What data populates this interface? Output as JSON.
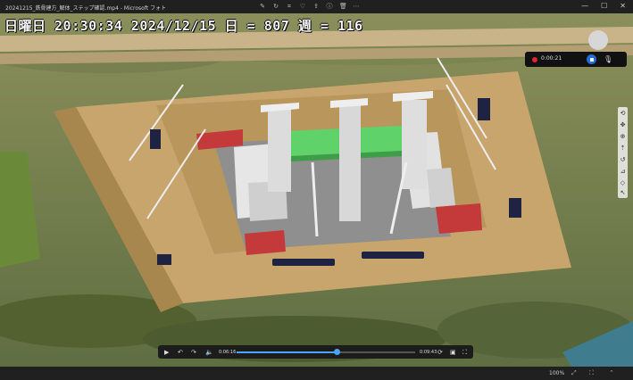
{
  "window": {
    "title": "20241215_鉄骨建方_解体_ステップ確認.mp4 - Microsoft フォト"
  },
  "overlay": {
    "timestamp": "日曜日 20:30:34 2024/12/15 日 = 807 週 = 116"
  },
  "recorder": {
    "elapsed": "0:00:21"
  },
  "player": {
    "current_time": "0:06:16",
    "total_time": "0:09:43",
    "progress": 0.56
  },
  "statusbar": {
    "zoom": "100%"
  },
  "colors": {
    "record_red": "#e0223a",
    "accent_blue": "#1e6fd9",
    "seek_blue": "#4da3ff"
  }
}
